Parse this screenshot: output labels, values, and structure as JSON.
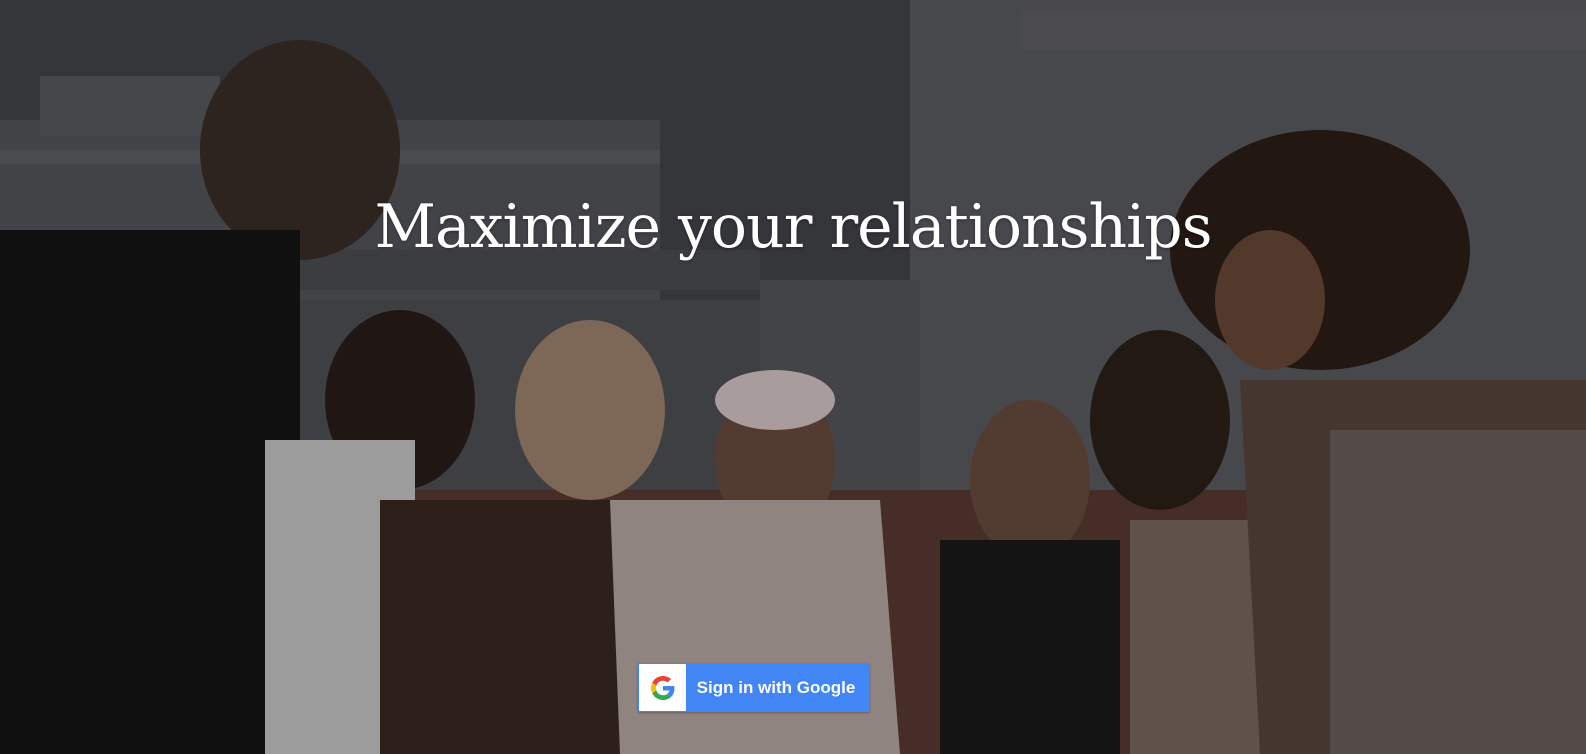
{
  "hero": {
    "headline": "Maximize your relationships",
    "photo_icon": "group-of-friends-photo"
  },
  "signin": {
    "label": "Sign in with Google",
    "icon": "google-g-icon",
    "button_color": "#4285f4"
  }
}
